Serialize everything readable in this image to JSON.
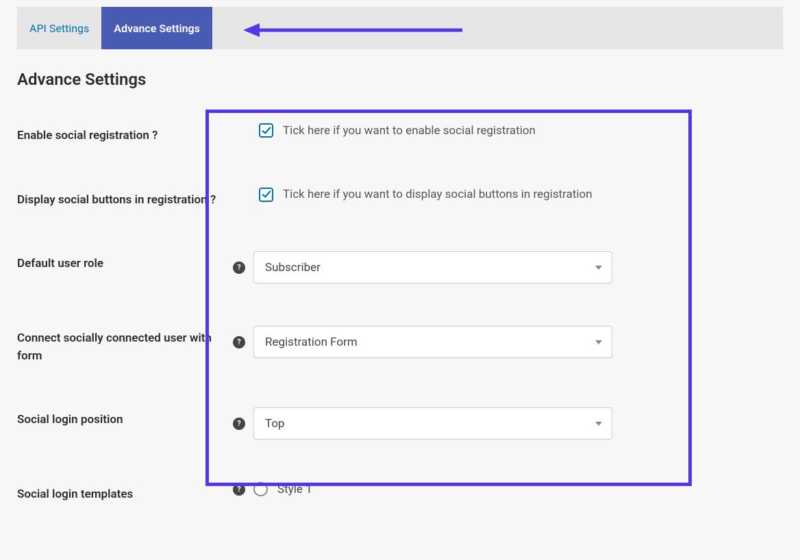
{
  "tabs": {
    "api_settings": "API Settings",
    "advance_settings": "Advance Settings"
  },
  "page_title": "Advance Settings",
  "fields": {
    "enable_social_registration": {
      "label": "Enable social registration ?",
      "checkbox_text": "Tick here if you want to enable social registration",
      "checked": true
    },
    "display_social_buttons": {
      "label": "Display social buttons in registration ?",
      "checkbox_text": "Tick here if you want to display social buttons in registration",
      "checked": true
    },
    "default_user_role": {
      "label": "Default user role",
      "value": "Subscriber"
    },
    "connect_socially": {
      "label": "Connect socially connected user with form",
      "value": "Registration Form"
    },
    "social_login_position": {
      "label": "Social login position",
      "value": "Top"
    },
    "social_login_templates": {
      "label": "Social login templates",
      "option": "Style 1"
    }
  },
  "annotation": {
    "arrow_color": "#5734ea",
    "highlight_color": "#5734ea"
  }
}
